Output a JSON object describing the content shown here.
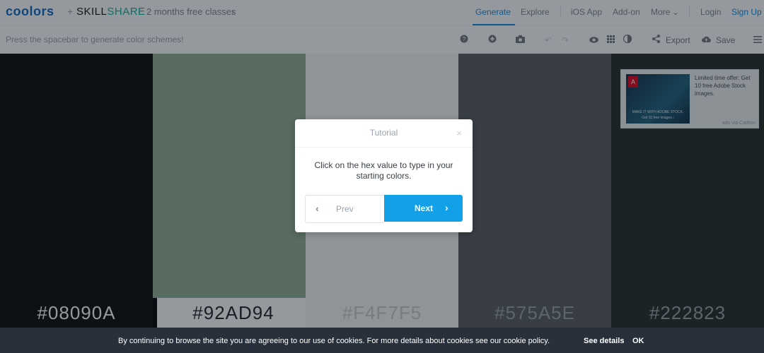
{
  "header": {
    "brand": "coolors",
    "partner": "+",
    "partner_brand_prefix": "SKILL",
    "partner_brand_suffix": "SHARE",
    "promo_text": "2 months free classes",
    "promo_chevron": "›",
    "nav": [
      "Generate",
      "Explore",
      "iOS App",
      "Add-on",
      "More",
      "Login",
      "Sign Up"
    ],
    "more_chevron": "⌄",
    "accent_color": "#0b8be0"
  },
  "toolbar": {
    "hint": "Press the spacebar to generate color schemes!",
    "icons": [
      "help-icon",
      "add-icon",
      "camera-icon",
      "undo-icon",
      "redo-icon",
      "view-icon",
      "grid-icon",
      "adjust-icon",
      "share-icon",
      "cloud-icon",
      "menu-icon"
    ],
    "export_label": "Export",
    "save_label": "Save"
  },
  "palette": {
    "colors": [
      {
        "hex": "#08090A",
        "label": "#08090A",
        "text_color": "#ffffff"
      },
      {
        "hex": "#92AD94",
        "label": "#92AD94",
        "text_color": "#1b1f24"
      },
      {
        "hex": "#F4F7F5",
        "label": "#F4F7F5",
        "text_color": "#c7cbc9"
      },
      {
        "hex": "#575A5E",
        "label": "#575A5E",
        "text_color": "#9aa0a6"
      },
      {
        "hex": "#222823",
        "label": "#222823",
        "text_color": "#9aa0a6"
      }
    ]
  },
  "ad": {
    "brand_mark": "A",
    "image_line_1": "MAKE IT WITH ADOBE STOCK.",
    "image_line_2": "Get 10 free images ›",
    "text": "Limited time offer: Get 10 free Adobe Stock images.",
    "via": "ads via Carbon"
  },
  "modal": {
    "title": "Tutorial",
    "close": "×",
    "body": "Click on the hex value to type in your starting colors.",
    "prev_label": "Prev",
    "next_label": "Next",
    "prev_icon": "‹",
    "next_icon": "›"
  },
  "cookie": {
    "text": "By continuing to browse the site you are agreeing to our use of cookies. For more details about cookies see our cookie policy.",
    "details_label": "See details",
    "ok_label": "OK"
  }
}
